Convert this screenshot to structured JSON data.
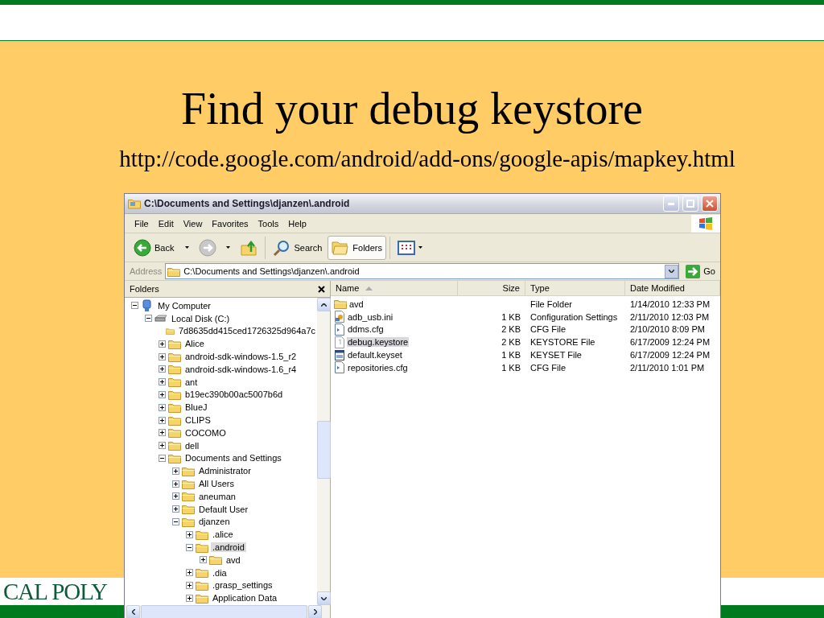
{
  "slide": {
    "title": "Find your debug keystore",
    "url": "http://code.google.com/android/add-ons/google-apis/mapkey.html",
    "logo": "CAL POLY"
  },
  "window": {
    "title": "C:\\Documents and Settings\\djanzen\\.android"
  },
  "menu": [
    "File",
    "Edit",
    "View",
    "Favorites",
    "Tools",
    "Help"
  ],
  "toolbar": [
    {
      "kind": "back",
      "label": "Back",
      "selected": false
    },
    {
      "kind": "forward",
      "selected": false
    },
    {
      "kind": "up",
      "selected": false
    },
    {
      "kind": "search",
      "label": "Search",
      "selected": false
    },
    {
      "kind": "folders",
      "label": "Folders",
      "selected": true
    },
    {
      "kind": "views",
      "selected": false
    }
  ],
  "address": {
    "label": "Address",
    "value": "C:\\Documents and Settings\\djanzen\\.android",
    "go": "Go"
  },
  "folders_pane": {
    "title": "Folders"
  },
  "tree": [
    {
      "label": "My Computer",
      "kind": "computer",
      "has_expander": true,
      "selected": false,
      "children": [
        {
          "label": "Local Disk (C:)",
          "kind": "drive",
          "has_expander": true,
          "selected": false,
          "children": [
            {
              "label": "7d8635dd415ced1726325d964a7c",
              "kind": "folder",
              "has_expander": false,
              "selected": false
            },
            {
              "label": "Alice",
              "kind": "folder",
              "has_expander": true,
              "selected": false
            },
            {
              "label": "android-sdk-windows-1.5_r2",
              "kind": "folder",
              "has_expander": true,
              "selected": false
            },
            {
              "label": "android-sdk-windows-1.6_r4",
              "kind": "folder",
              "has_expander": true,
              "selected": false
            },
            {
              "label": "ant",
              "kind": "folder",
              "has_expander": true,
              "selected": false
            },
            {
              "label": "b19ec390b00ac5007b6d",
              "kind": "folder",
              "has_expander": true,
              "selected": false
            },
            {
              "label": "BlueJ",
              "kind": "folder",
              "has_expander": true,
              "selected": false
            },
            {
              "label": "CLIPS",
              "kind": "folder",
              "has_expander": true,
              "selected": false
            },
            {
              "label": "COCOMO",
              "kind": "folder",
              "has_expander": true,
              "selected": false
            },
            {
              "label": "dell",
              "kind": "folder",
              "has_expander": true,
              "selected": false
            },
            {
              "label": "Documents and Settings",
              "kind": "folder",
              "has_expander": true,
              "selected": false,
              "children": [
                {
                  "label": "Administrator",
                  "kind": "folder",
                  "has_expander": true,
                  "selected": false
                },
                {
                  "label": "All Users",
                  "kind": "folder",
                  "has_expander": true,
                  "selected": false
                },
                {
                  "label": "aneuman",
                  "kind": "folder",
                  "has_expander": true,
                  "selected": false
                },
                {
                  "label": "Default User",
                  "kind": "folder",
                  "has_expander": true,
                  "selected": false
                },
                {
                  "label": "djanzen",
                  "kind": "folder",
                  "has_expander": true,
                  "selected": false,
                  "children": [
                    {
                      "label": ".alice",
                      "kind": "folder",
                      "has_expander": true,
                      "selected": false
                    },
                    {
                      "label": ".android",
                      "kind": "folder",
                      "has_expander": true,
                      "selected": true,
                      "children": [
                        {
                          "label": "avd",
                          "kind": "folder",
                          "has_expander": true,
                          "selected": false
                        }
                      ]
                    },
                    {
                      "label": ".dia",
                      "kind": "folder",
                      "has_expander": true,
                      "selected": false
                    },
                    {
                      "label": ".grasp_settings",
                      "kind": "folder",
                      "has_expander": true,
                      "selected": false
                    },
                    {
                      "label": "Application Data",
                      "kind": "folder",
                      "has_expander": true,
                      "selected": false
                    }
                  ]
                }
              ]
            }
          ]
        }
      ]
    }
  ],
  "columns": [
    {
      "label": "Name",
      "sorted": true
    },
    {
      "label": "Size",
      "sorted": false
    },
    {
      "label": "Type",
      "sorted": false
    },
    {
      "label": "Date Modified",
      "sorted": false
    }
  ],
  "files": [
    {
      "name": "avd",
      "kind": "folder",
      "type": "File Folder",
      "modified": "1/14/2010 12:33 PM",
      "selected": false
    },
    {
      "name": "adb_usb.ini",
      "kind": "settings",
      "size": "1 KB",
      "type": "Configuration Settings",
      "modified": "2/11/2010 12:03 PM",
      "selected": false
    },
    {
      "name": "ddms.cfg",
      "kind": "document",
      "size": "2 KB",
      "type": "CFG File",
      "modified": "2/10/2010 8:09 PM",
      "selected": false
    },
    {
      "name": "debug.keystore",
      "kind": "unknown",
      "size": "2 KB",
      "type": "KEYSTORE File",
      "modified": "6/17/2009 12:24 PM",
      "selected": true
    },
    {
      "name": "default.keyset",
      "kind": "window",
      "size": "1 KB",
      "type": "KEYSET File",
      "modified": "6/17/2009 12:24 PM",
      "selected": false
    },
    {
      "name": "repositories.cfg",
      "kind": "document",
      "size": "1 KB",
      "type": "CFG File",
      "modified": "2/11/2010 1:01 PM",
      "selected": false
    }
  ]
}
